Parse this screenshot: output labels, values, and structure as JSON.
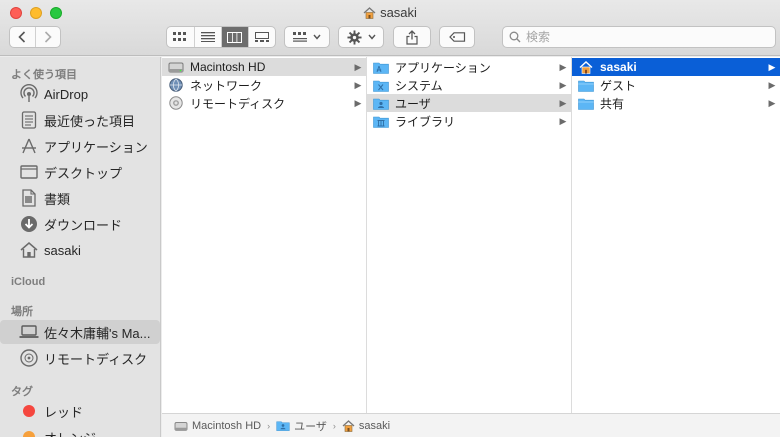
{
  "window": {
    "title": "sasaki"
  },
  "toolbar": {
    "search_placeholder": "検索"
  },
  "sidebar": {
    "favorites_header": "よく使う項目",
    "favorites": [
      {
        "label": "AirDrop",
        "icon": "airdrop-icon"
      },
      {
        "label": "最近使った項目",
        "icon": "recents-icon"
      },
      {
        "label": "アプリケーション",
        "icon": "applications-icon"
      },
      {
        "label": "デスクトップ",
        "icon": "desktop-icon"
      },
      {
        "label": "書類",
        "icon": "documents-icon"
      },
      {
        "label": "ダウンロード",
        "icon": "downloads-icon"
      },
      {
        "label": "sasaki",
        "icon": "home-icon"
      }
    ],
    "icloud_header": "iCloud",
    "locations_header": "場所",
    "locations": [
      {
        "label": "佐々木庸輔's Ma...",
        "icon": "laptop-icon"
      },
      {
        "label": "リモートディスク",
        "icon": "remote-disc-icon"
      }
    ],
    "tags_header": "タグ",
    "tags": [
      {
        "label": "レッド",
        "color": "#f5473f"
      },
      {
        "label": "オレンジ",
        "color": "#f6a03c"
      }
    ]
  },
  "columns": [
    {
      "items": [
        {
          "label": "Macintosh HD",
          "icon": "hard-drive-icon",
          "selected": "gray"
        },
        {
          "label": "ネットワーク",
          "icon": "network-globe-icon"
        },
        {
          "label": "リモートディスク",
          "icon": "remote-disc-icon"
        }
      ]
    },
    {
      "items": [
        {
          "label": "アプリケーション",
          "icon": "applications-folder-icon"
        },
        {
          "label": "システム",
          "icon": "system-folder-icon"
        },
        {
          "label": "ユーザ",
          "icon": "users-folder-icon",
          "selected": "gray"
        },
        {
          "label": "ライブラリ",
          "icon": "library-folder-icon"
        }
      ]
    },
    {
      "items": [
        {
          "label": "sasaki",
          "icon": "home-folder-icon",
          "selected": "blue"
        },
        {
          "label": "ゲスト",
          "icon": "folder-icon"
        },
        {
          "label": "共有",
          "icon": "folder-icon"
        }
      ]
    }
  ],
  "pathbar": {
    "segments": [
      {
        "label": "Macintosh HD",
        "icon": "hard-drive-icon"
      },
      {
        "label": "ユーザ",
        "icon": "users-folder-icon"
      },
      {
        "label": "sasaki",
        "icon": "home-icon"
      }
    ]
  },
  "colors": {
    "selection_blue": "#0a5fd7",
    "folder_blue": "#5cb6f5"
  }
}
